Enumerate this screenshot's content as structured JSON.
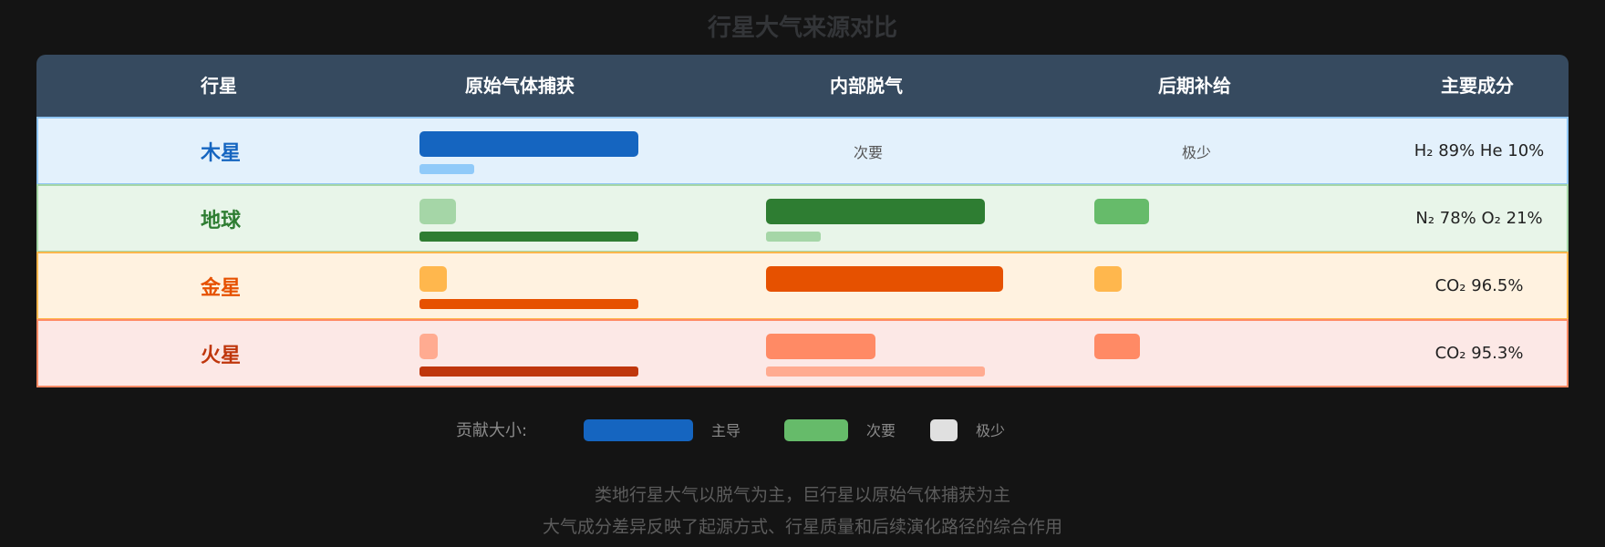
{
  "title": "行星大气来源对比",
  "chart_data": {
    "type": "table",
    "title": "行星大气来源对比",
    "columns": [
      "行星",
      "原始气体捕获",
      "内部脱气",
      "后期补给",
      "主要成分"
    ],
    "rows": [
      {
        "planet": "木星",
        "capture": "主导",
        "outgassing": "次要",
        "supply": "极少",
        "composition": "H₂ 89% He 10%",
        "outgassing_text": "次要",
        "supply_text": "极少",
        "colors": {
          "name": "#1565c0",
          "bg": "#e3f1fc",
          "border": "#90c6f3",
          "main": "#1565c0",
          "light": "#90caf9"
        }
      },
      {
        "planet": "地球",
        "capture": "极少",
        "outgassing": "主导",
        "supply": "次要",
        "composition": "N₂ 78% O₂ 21%",
        "colors": {
          "name": "#2e7d32",
          "bg": "#e8f5e9",
          "border": "#a5d6a7",
          "main": "#2e7d32",
          "light": "#a5d6a7",
          "mid": "#66bb6a"
        }
      },
      {
        "planet": "金星",
        "capture": "极少",
        "outgassing": "主导",
        "supply": "极少",
        "composition": "CO₂ 96.5%",
        "colors": {
          "name": "#e65100",
          "bg": "#fff2e0",
          "border": "#ffb74d",
          "main": "#e65100",
          "light": "#ffb74d"
        }
      },
      {
        "planet": "火星",
        "capture": "极少",
        "outgassing": "次要",
        "supply": "次要",
        "composition": "CO₂ 95.3%",
        "colors": {
          "name": "#bf360c",
          "bg": "#fce8e6",
          "border": "#ff8a65",
          "main": "#bf360c",
          "light": "#ffab91",
          "mid": "#ff8a65"
        }
      }
    ],
    "legend": {
      "title": "贡献大小:",
      "items": [
        {
          "label": "主导",
          "color": "#1565c0"
        },
        {
          "label": "次要",
          "color": "#66bb6a"
        },
        {
          "label": "极少",
          "color": "#e0e0e0"
        }
      ]
    }
  },
  "notes": [
    "类地行星大气以脱气为主，巨行星以原始气体捕获为主",
    "大气成分差异反映了起源方式、行星质量和后续演化路径的综合作用"
  ]
}
